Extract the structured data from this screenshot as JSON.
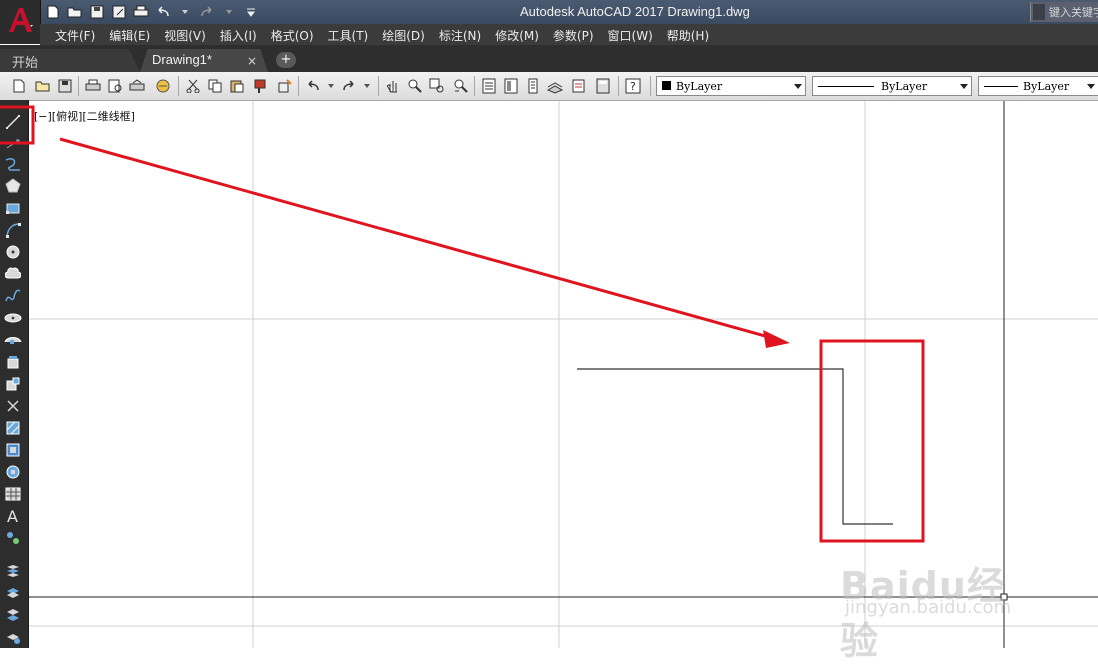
{
  "window": {
    "title": "Autodesk AutoCAD 2017    Drawing1.dwg",
    "search_placeholder": "键入关键字"
  },
  "menu": [
    "文件(F)",
    "编辑(E)",
    "视图(V)",
    "插入(I)",
    "格式(O)",
    "工具(T)",
    "绘图(D)",
    "标注(N)",
    "修改(M)",
    "参数(P)",
    "窗口(W)",
    "帮助(H)"
  ],
  "tabs": {
    "start": "开始",
    "drawing": "Drawing1*",
    "close": "×",
    "add": "+"
  },
  "toolbar": {
    "color_value": "ByLayer",
    "linetype_value": "ByLayer",
    "lineweight_value": "ByLayer"
  },
  "viewport": {
    "label": "[−][俯视][二维线框]"
  },
  "watermark": {
    "logo": "Baidu经验",
    "url": "jingyan.baidu.com"
  },
  "colors": {
    "annotation_red": "#e0141e",
    "title_bar": "#44546a",
    "menu_bg": "#3b3b3b",
    "app_button_red": "#c8102e"
  },
  "icons": {
    "app_menu": "autocad-logo-icon",
    "highlighted_tool": "line-tool-icon"
  }
}
